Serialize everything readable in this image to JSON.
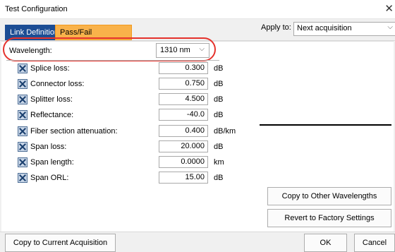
{
  "window": {
    "title": "Test Configuration",
    "close_glyph": "✕"
  },
  "tabs": [
    {
      "label": "Link Definition",
      "active": false
    },
    {
      "label": "Pass/Fail Thresholds",
      "active": true
    }
  ],
  "apply_to": {
    "label": "Apply to:",
    "value": "Next acquisition"
  },
  "wavelength": {
    "label": "Wavelength:",
    "value": "1310 nm"
  },
  "rows": [
    {
      "label": "Splice loss:",
      "value": "0.300",
      "unit": "dB",
      "checked": true
    },
    {
      "label": "Connector loss:",
      "value": "0.750",
      "unit": "dB",
      "checked": true
    },
    {
      "label": "Splitter loss:",
      "value": "4.500",
      "unit": "dB",
      "checked": true
    },
    {
      "label": "Reflectance:",
      "value": "-40.0",
      "unit": "dB",
      "checked": true
    },
    {
      "label": "Fiber section attenuation:",
      "value": "0.400",
      "unit": "dB/km",
      "checked": true
    },
    {
      "label": "Span loss:",
      "value": "20.000",
      "unit": "dB",
      "checked": true
    },
    {
      "label": "Span length:",
      "value": "0.0000",
      "unit": "km",
      "checked": true
    },
    {
      "label": "Span ORL:",
      "value": "15.00",
      "unit": "dB",
      "checked": true
    }
  ],
  "buttons": {
    "copy_wavelengths": "Copy to Other Wavelengths",
    "revert": "Revert to Factory Settings",
    "copy_current": "Copy to Current Acquisition",
    "ok": "OK",
    "cancel": "Cancel"
  },
  "colors": {
    "active_tab": "#f9b24a",
    "inactive_tab": "#1c4d94",
    "highlight": "#e5322c"
  }
}
